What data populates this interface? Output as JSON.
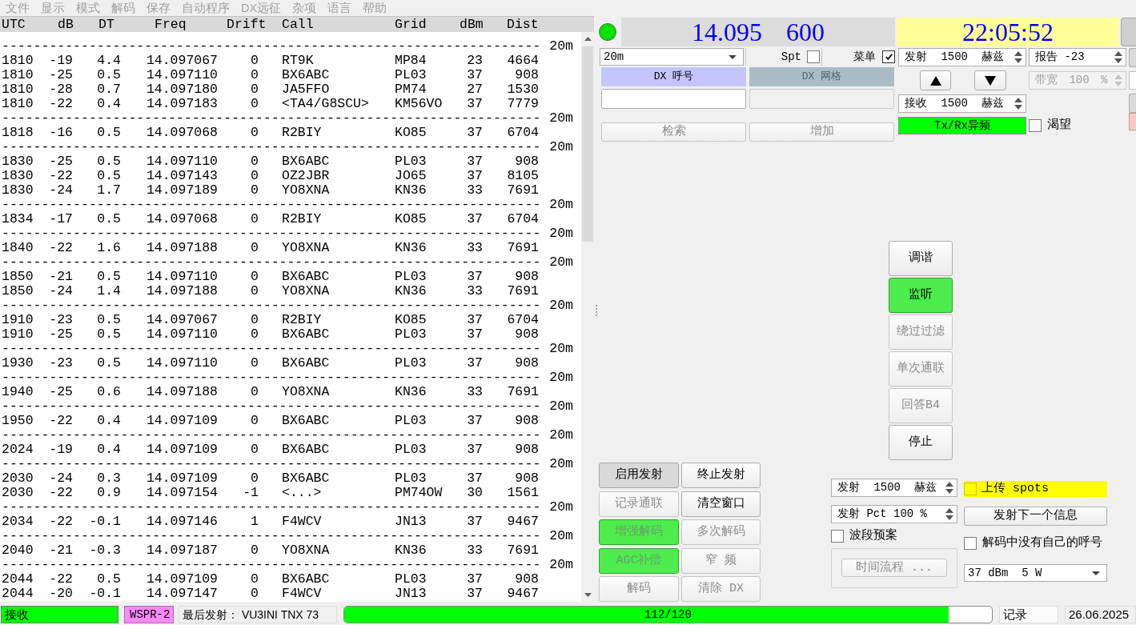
{
  "menu_bar": [
    {
      "label": "文件",
      "disabled": true
    },
    {
      "label": "显示",
      "disabled": true
    },
    {
      "label": "模式",
      "disabled": true
    },
    {
      "label": "解码",
      "disabled": true
    },
    {
      "label": "保存",
      "disabled": true
    },
    {
      "label": "自动程序",
      "disabled": true
    },
    {
      "label": "DX远征",
      "disabled": true
    },
    {
      "label": "杂项",
      "disabled": true
    },
    {
      "label": "语言",
      "disabled": true
    },
    {
      "label": "帮助",
      "disabled": true
    }
  ],
  "decode_list": {
    "columns": [
      "UTC",
      "dB",
      "DT",
      "Freq",
      "Drift",
      "Call",
      "Grid",
      "dBm",
      "Dist"
    ],
    "rows": [
      {
        "kind": "separator",
        "rule": "--------------------------------------------------------------------",
        "band": "20m"
      },
      {
        "kind": "decode",
        "cells": [
          "1810",
          "-19",
          "4.4",
          "14.097067",
          "0",
          "RT9K",
          "MP84",
          "23",
          "4664"
        ]
      },
      {
        "kind": "decode",
        "cells": [
          "1810",
          "-25",
          "0.5",
          "14.097110",
          "0",
          "BX6ABC",
          "PL03",
          "37",
          "908"
        ]
      },
      {
        "kind": "decode",
        "cells": [
          "1810",
          "-28",
          "0.7",
          "14.097180",
          "0",
          "JA5FFO",
          "PM74",
          "27",
          "1530"
        ]
      },
      {
        "kind": "decode",
        "cells": [
          "1810",
          "-22",
          "0.4",
          "14.097183",
          "0",
          "<TA4/G8SCU>",
          "KM56VO",
          "37",
          "7779"
        ]
      },
      {
        "kind": "separator",
        "rule": "--------------------------------------------------------------------",
        "band": "20m"
      },
      {
        "kind": "decode",
        "cells": [
          "1818",
          "-16",
          "0.5",
          "14.097068",
          "0",
          "R2BIY",
          "KO85",
          "37",
          "6704"
        ]
      },
      {
        "kind": "separator",
        "rule": "--------------------------------------------------------------------",
        "band": "20m"
      },
      {
        "kind": "decode",
        "cells": [
          "1830",
          "-25",
          "0.5",
          "14.097110",
          "0",
          "BX6ABC",
          "PL03",
          "37",
          "908"
        ]
      },
      {
        "kind": "decode",
        "cells": [
          "1830",
          "-22",
          "0.5",
          "14.097143",
          "0",
          "OZ2JBR",
          "JO65",
          "37",
          "8105"
        ]
      },
      {
        "kind": "decode",
        "cells": [
          "1830",
          "-24",
          "1.7",
          "14.097189",
          "0",
          "YO8XNA",
          "KN36",
          "33",
          "7691"
        ]
      },
      {
        "kind": "separator",
        "rule": "--------------------------------------------------------------------",
        "band": "20m"
      },
      {
        "kind": "decode",
        "cells": [
          "1834",
          "-17",
          "0.5",
          "14.097068",
          "0",
          "R2BIY",
          "KO85",
          "37",
          "6704"
        ]
      },
      {
        "kind": "separator",
        "rule": "--------------------------------------------------------------------",
        "band": "20m"
      },
      {
        "kind": "decode",
        "cells": [
          "1840",
          "-22",
          "1.6",
          "14.097188",
          "0",
          "YO8XNA",
          "KN36",
          "33",
          "7691"
        ]
      },
      {
        "kind": "separator",
        "rule": "--------------------------------------------------------------------",
        "band": "20m"
      },
      {
        "kind": "decode",
        "cells": [
          "1850",
          "-21",
          "0.5",
          "14.097110",
          "0",
          "BX6ABC",
          "PL03",
          "37",
          "908"
        ]
      },
      {
        "kind": "decode",
        "cells": [
          "1850",
          "-24",
          "1.4",
          "14.097188",
          "0",
          "YO8XNA",
          "KN36",
          "33",
          "7691"
        ]
      },
      {
        "kind": "separator",
        "rule": "--------------------------------------------------------------------",
        "band": "20m"
      },
      {
        "kind": "decode",
        "cells": [
          "1910",
          "-23",
          "0.5",
          "14.097067",
          "0",
          "R2BIY",
          "KO85",
          "37",
          "6704"
        ]
      },
      {
        "kind": "decode",
        "cells": [
          "1910",
          "-25",
          "0.5",
          "14.097110",
          "0",
          "BX6ABC",
          "PL03",
          "37",
          "908"
        ]
      },
      {
        "kind": "separator",
        "rule": "--------------------------------------------------------------------",
        "band": "20m"
      },
      {
        "kind": "decode",
        "cells": [
          "1930",
          "-23",
          "0.5",
          "14.097110",
          "0",
          "BX6ABC",
          "PL03",
          "37",
          "908"
        ]
      },
      {
        "kind": "separator",
        "rule": "--------------------------------------------------------------------",
        "band": "20m"
      },
      {
        "kind": "decode",
        "cells": [
          "1940",
          "-25",
          "0.6",
          "14.097188",
          "0",
          "YO8XNA",
          "KN36",
          "33",
          "7691"
        ]
      },
      {
        "kind": "separator",
        "rule": "--------------------------------------------------------------------",
        "band": "20m"
      },
      {
        "kind": "decode",
        "cells": [
          "1950",
          "-22",
          "0.4",
          "14.097109",
          "0",
          "BX6ABC",
          "PL03",
          "37",
          "908"
        ]
      },
      {
        "kind": "separator",
        "rule": "--------------------------------------------------------------------",
        "band": "20m"
      },
      {
        "kind": "decode",
        "cells": [
          "2024",
          "-19",
          "0.4",
          "14.097109",
          "0",
          "BX6ABC",
          "PL03",
          "37",
          "908"
        ]
      },
      {
        "kind": "separator",
        "rule": "--------------------------------------------------------------------",
        "band": "20m"
      },
      {
        "kind": "decode",
        "cells": [
          "2030",
          "-24",
          "0.3",
          "14.097109",
          "0",
          "BX6ABC",
          "PL03",
          "37",
          "908"
        ]
      },
      {
        "kind": "decode",
        "cells": [
          "2030",
          "-22",
          "0.9",
          "14.097154",
          "-1",
          "<...>",
          "PM74OW",
          "30",
          "1561"
        ]
      },
      {
        "kind": "separator",
        "rule": "--------------------------------------------------------------------",
        "band": "20m"
      },
      {
        "kind": "decode",
        "cells": [
          "2034",
          "-22",
          "-0.1",
          "14.097146",
          "1",
          "F4WCV",
          "JN13",
          "37",
          "9467"
        ]
      },
      {
        "kind": "separator",
        "rule": "--------------------------------------------------------------------",
        "band": "20m"
      },
      {
        "kind": "decode",
        "cells": [
          "2040",
          "-21",
          "-0.3",
          "14.097187",
          "0",
          "YO8XNA",
          "KN36",
          "33",
          "7691"
        ]
      },
      {
        "kind": "separator",
        "rule": "--------------------------------------------------------------------",
        "band": "20m"
      },
      {
        "kind": "decode",
        "cells": [
          "2044",
          "-22",
          "0.5",
          "14.097109",
          "0",
          "BX6ABC",
          "PL03",
          "37",
          "908"
        ]
      },
      {
        "kind": "decode",
        "cells": [
          "2044",
          "-20",
          "-0.1",
          "14.097147",
          "0",
          "F4WCV",
          "JN13",
          "37",
          "9467"
        ]
      }
    ]
  },
  "control_panel": {
    "dial_frequency": "14.095 600",
    "clock": "22:05:52",
    "band": "20m",
    "toggles": [
      {
        "label": "Spt",
        "checked": false
      },
      {
        "label": "菜单",
        "checked": true
      }
    ],
    "dx_call": {
      "label": "DX 呼号",
      "disabled": false
    },
    "dx_grid": {
      "label": "DX 网格",
      "disabled": true
    },
    "lookup_buttons": [
      {
        "label": "检索",
        "disabled": true
      },
      {
        "label": "增加",
        "disabled": true
      }
    ],
    "tx_frequency": {
      "text": "发射 1500 赫兹",
      "disabled": false
    },
    "rx_frequency": {
      "text": "接收 1500 赫兹",
      "disabled": false
    },
    "report": {
      "text": "报告 -23",
      "disabled": false
    },
    "bandwidth": {
      "text": "带宽 100 %",
      "disabled": true
    },
    "split_indicator": {
      "label": "Tx/Rx异频",
      "on": true
    },
    "hold_tx": {
      "label": "渴望",
      "checked": false
    },
    "sequence_buttons": [
      {
        "label": "调谐",
        "checked": false,
        "disabled": false
      },
      {
        "label": "监听",
        "checked": true,
        "disabled": false
      },
      {
        "label": "绕过过滤",
        "checked": false,
        "disabled": true
      },
      {
        "label": "单次通联",
        "checked": false,
        "disabled": true
      },
      {
        "label": "回答B4",
        "checked": false,
        "disabled": true
      },
      {
        "label": "停止",
        "checked": false,
        "disabled": false
      }
    ],
    "action_buttons": [
      {
        "label": "启用发射",
        "checked": false,
        "disabled": false,
        "pressed": true
      },
      {
        "label": "终止发射",
        "checked": false,
        "disabled": false,
        "pressed": false
      },
      {
        "label": "记录通联",
        "checked": false,
        "disabled": true,
        "pressed": false
      },
      {
        "label": "清空窗口",
        "checked": false,
        "disabled": false,
        "pressed": false
      },
      {
        "label": "增强解码",
        "checked": true,
        "disabled": true,
        "pressed": false
      },
      {
        "label": "多次解码",
        "checked": false,
        "disabled": true,
        "pressed": false
      },
      {
        "label": "AGC补偿",
        "checked": true,
        "disabled": true,
        "pressed": false
      },
      {
        "label": "窄 频",
        "checked": false,
        "disabled": true,
        "pressed": false
      },
      {
        "label": "解码",
        "checked": false,
        "disabled": true,
        "pressed": false
      },
      {
        "label": "清除 DX",
        "checked": false,
        "disabled": true,
        "pressed": false
      }
    ],
    "wspr_tx_frequency": {
      "text": "发射 1500 赫兹",
      "disabled": false
    },
    "tx_percent": {
      "text": "发射 Pct 100 %",
      "disabled": false
    },
    "band_hopping": {
      "label": "波段预案",
      "checked": false
    },
    "schedule_button": {
      "label": "时间流程 ...",
      "disabled": true
    },
    "upload_spots": {
      "label": "上传 spots",
      "checked": false
    },
    "tx_next_button": {
      "label": "发射下一个信息"
    },
    "no_own_call": {
      "label": "解码中没有自己的呼号",
      "checked": false
    },
    "power": "37 dBm  5 W"
  },
  "status_bar": {
    "tx_state": "接收",
    "mode": "WSPR-2",
    "last_tx": "最后发射： VU3INI TNX 73",
    "progress": {
      "text": "112/120",
      "level": 0.933
    },
    "log": "记录",
    "date": "26.06.2025"
  }
}
